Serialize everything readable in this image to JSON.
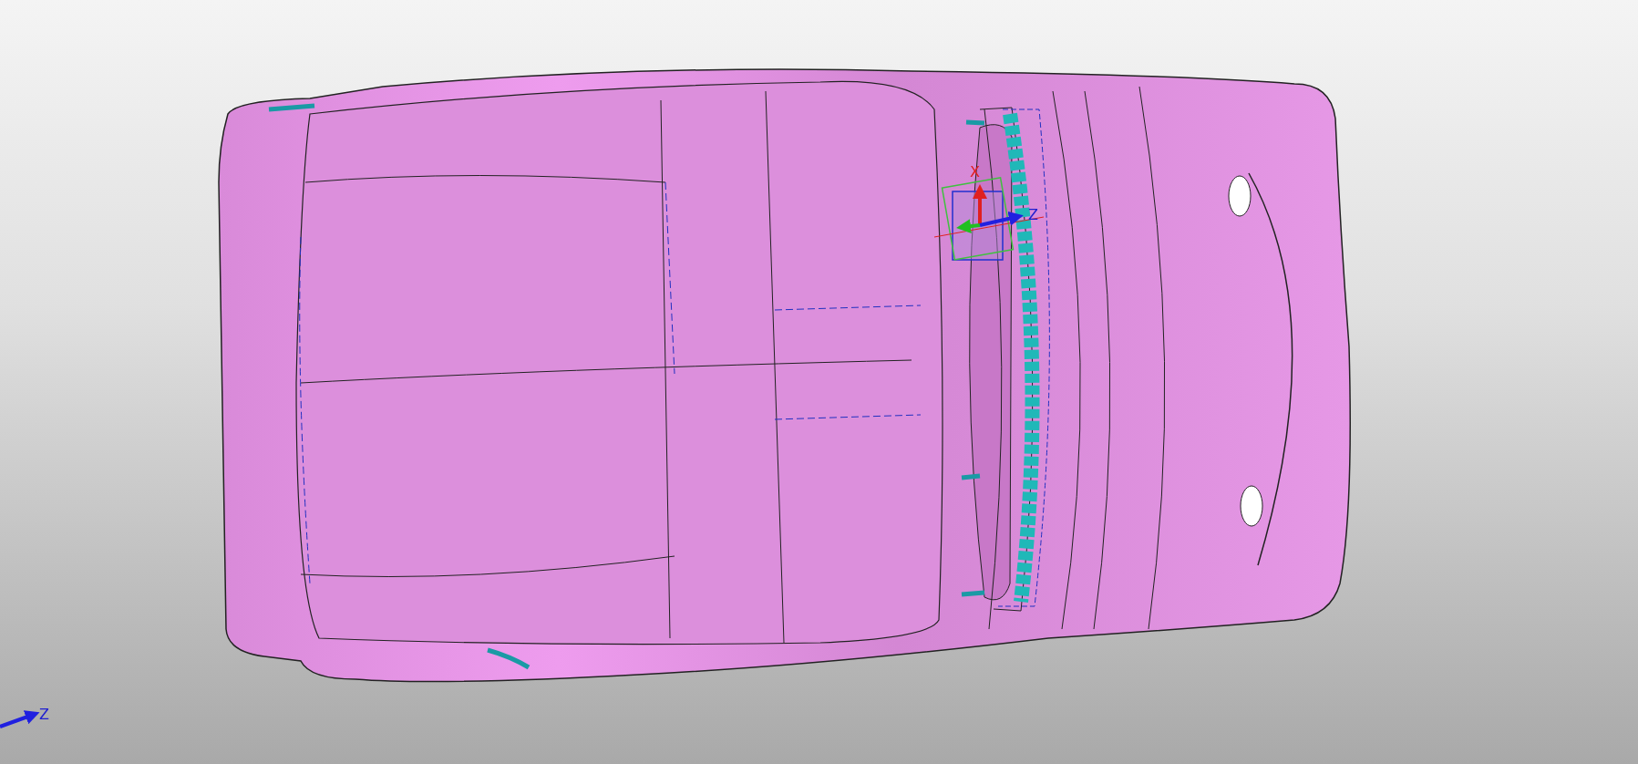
{
  "viewport": {
    "triad": {
      "x_label": "X",
      "z_label": "Z"
    },
    "corner_axis": {
      "z_label": "Z"
    }
  }
}
